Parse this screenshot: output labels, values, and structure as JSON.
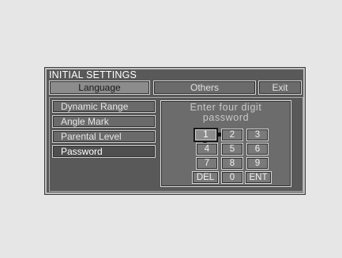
{
  "window": {
    "title": "INITIAL SETTINGS"
  },
  "tabs": [
    {
      "label": "Language"
    },
    {
      "label": "Others"
    },
    {
      "label": "Exit"
    }
  ],
  "menu": {
    "items": [
      {
        "label": "Dynamic Range"
      },
      {
        "label": "Angle Mark"
      },
      {
        "label": "Parental Level"
      },
      {
        "label": "Password"
      }
    ],
    "selected": "Password"
  },
  "password_panel": {
    "prompt_line1": "Enter four digit",
    "prompt_line2": "password",
    "keys": {
      "k1": "1",
      "k2": "2",
      "k3": "3",
      "k4": "4",
      "k5": "5",
      "k6": "6",
      "k7": "7",
      "k8": "8",
      "k9": "9",
      "del": "DEL",
      "k0": "0",
      "ent": "ENT"
    },
    "selected_key": "1"
  }
}
